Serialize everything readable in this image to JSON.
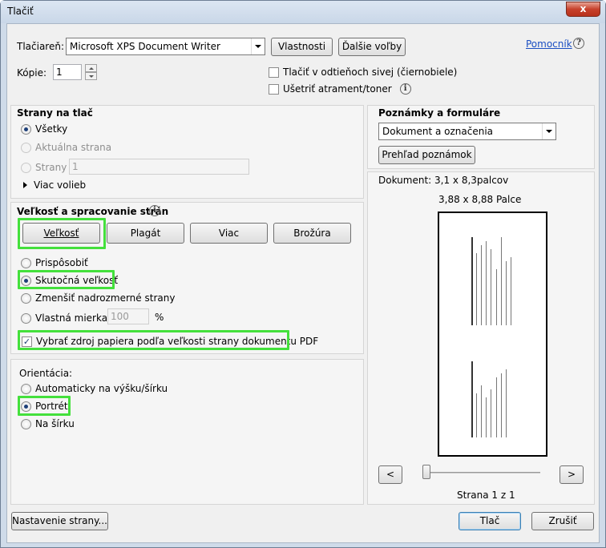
{
  "window": {
    "title": "Tlačiť",
    "close_glyph": "x"
  },
  "printer": {
    "label": "Tlačiareň:",
    "selected": "Microsoft XPS Document Writer",
    "properties_button": "Vlastnosti",
    "more_options_button": "Ďalšie voľby",
    "help_link": "Pomocník",
    "help_icon_glyph": "?"
  },
  "copies": {
    "label": "Kópie:",
    "value": "1"
  },
  "options": {
    "grayscale": {
      "label": "Tlačiť v odtieňoch sivej (čiernobiele)",
      "checked": false
    },
    "save_ink": {
      "label": "Ušetriť atrament/toner",
      "checked": false,
      "info_glyph": "i"
    }
  },
  "pages": {
    "heading": "Strany na tlač",
    "all": "Všetky",
    "current": "Aktuálna strana",
    "range_label": "Strany",
    "range_value": "1",
    "more": "Viac volieb"
  },
  "sizing": {
    "heading": "Veľkosť a spracovanie strán",
    "info_glyph": "i",
    "tabs": [
      "Veľkosť",
      "Plagát",
      "Viac",
      "Brožúra"
    ],
    "fit": "Prispôsobiť",
    "actual_size": "Skutočná veľkosť",
    "shrink": "Zmenšiť nadrozmerné strany",
    "custom_scale_label": "Vlastná mierka:",
    "custom_scale_value": "100",
    "percent": "%",
    "paper_source": {
      "label": "Vybrať zdroj papiera podľa veľkosti strany dokumentu PDF",
      "checked": true,
      "check_glyph": "✓"
    }
  },
  "orientation": {
    "heading": "Orientácia:",
    "auto": "Automaticky na výšku/šírku",
    "portrait": "Portrét",
    "landscape": "Na šírku"
  },
  "comments": {
    "heading": "Poznámky a formuláre",
    "selected": "Dokument a označenia",
    "summary_button": "Prehľad poznámok"
  },
  "preview": {
    "document_size": "Dokument: 3,1 x 8,3palcov",
    "paper_size": "3,88 x 8,88 Palce",
    "prev_button": "<",
    "next_button": ">",
    "page_status": "Strana 1 z 1"
  },
  "footer": {
    "page_setup_button": "Nastavenie strany...",
    "print_button": "Tlač",
    "cancel_button": "Zrušiť"
  }
}
